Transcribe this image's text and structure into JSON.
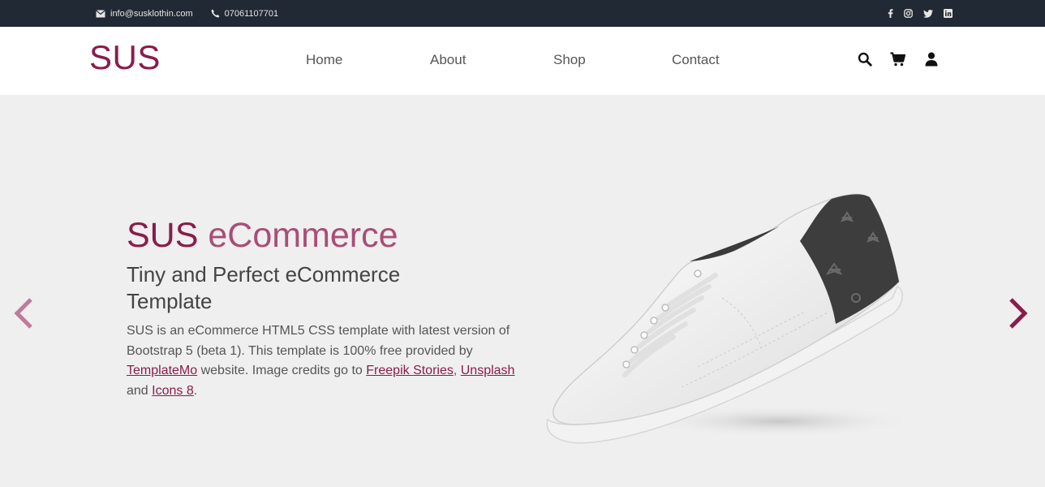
{
  "topbar": {
    "email": "info@susklothin.com",
    "phone": "07061107701",
    "social": [
      "facebook-icon",
      "instagram-icon",
      "twitter-icon",
      "linkedin-icon"
    ]
  },
  "header": {
    "logo": "SUS",
    "nav": [
      "Home",
      "About",
      "Shop",
      "Contact"
    ],
    "icons": [
      "search-icon",
      "cart-icon",
      "user-icon"
    ]
  },
  "hero": {
    "title_strong": "SUS",
    "title_light": " eCommerce",
    "subtitle": "Tiny and Perfect eCommerce Template",
    "desc_part1": "SUS is an eCommerce HTML5 CSS template with latest version of Bootstrap 5 (beta 1). This template is 100% free provided by ",
    "link1": "TemplateMo",
    "desc_part2": " website. Image credits go to ",
    "link2": "Freepik Stories",
    "desc_part3": ", ",
    "link3": "Unsplash",
    "desc_part4": " and ",
    "link4": "Icons 8",
    "desc_part5": "."
  },
  "colors": {
    "brand": "#8a1c4a",
    "topbar_bg": "#212934",
    "hero_bg": "#efefef"
  }
}
